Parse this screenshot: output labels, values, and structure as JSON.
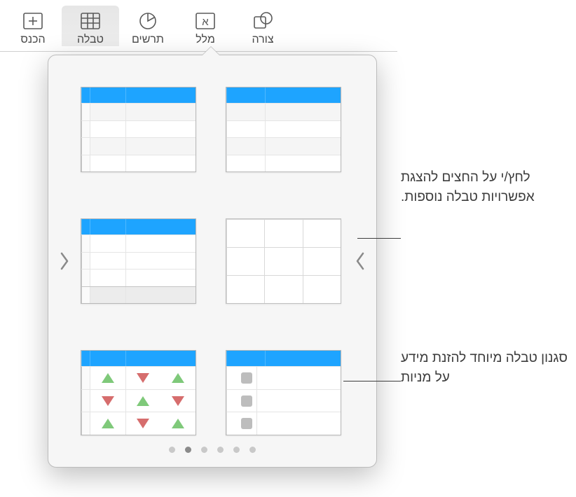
{
  "toolbar": {
    "items": [
      {
        "id": "insert",
        "label": "הכנס"
      },
      {
        "id": "table",
        "label": "טבלה",
        "active": true
      },
      {
        "id": "charts",
        "label": "תרשים"
      },
      {
        "id": "text",
        "label": "מלל"
      },
      {
        "id": "shape",
        "label": "צורה"
      }
    ]
  },
  "popover": {
    "page_count": 6,
    "active_page_index": 4,
    "styles": [
      {
        "id": "style-basic-blue",
        "variant": "v1"
      },
      {
        "id": "style-blue-sidecol",
        "variant": "v2"
      },
      {
        "id": "style-minimal-grid",
        "variant": "v3"
      },
      {
        "id": "style-blue-footer",
        "variant": "v4"
      },
      {
        "id": "style-checkbox",
        "variant": "v5"
      },
      {
        "id": "style-stock-arrows",
        "variant": "v6"
      }
    ]
  },
  "callouts": {
    "arrows_hint": "לחץ/י על החצים להצגת אפשרויות טבלה נוספות.",
    "stock_style_hint": "סגנון טבלה מיוחד להזנת מידע על מניות"
  },
  "icons": {
    "insert": "plus-in-frame",
    "table": "grid",
    "charts": "pie",
    "text": "text-box",
    "shape": "stacked-shapes",
    "nav_prev": "chevron-left",
    "nav_next": "chevron-right"
  }
}
